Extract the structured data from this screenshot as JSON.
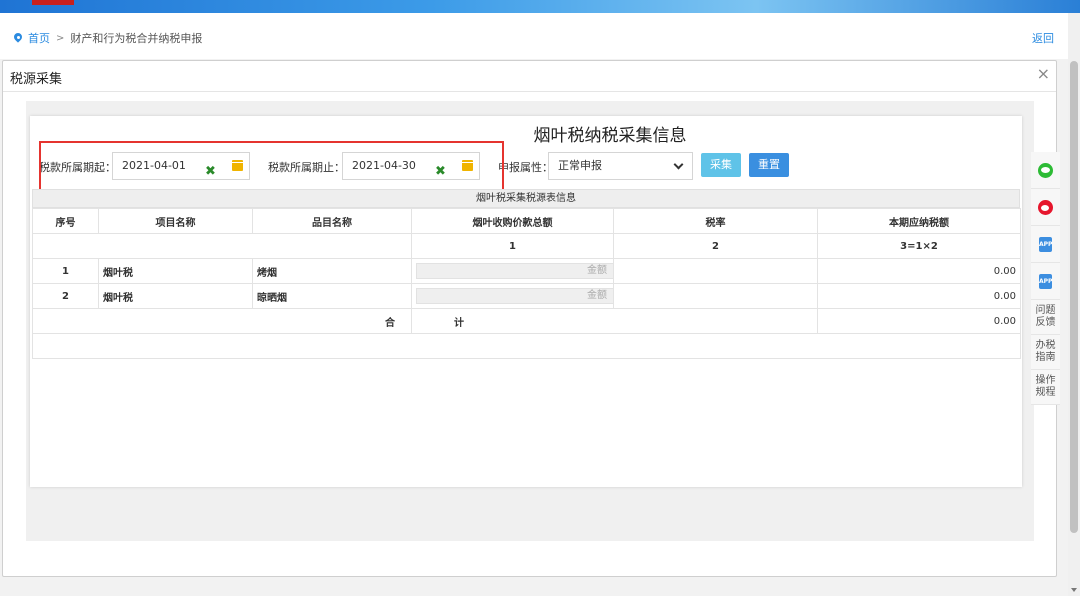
{
  "breadcrumb": {
    "home": "首页",
    "separator": ">",
    "current": "财产和行为税合并纳税申报",
    "back": "返回"
  },
  "modal": {
    "title": "税源采集",
    "close": "×"
  },
  "form": {
    "title": "烟叶税纳税采集信息",
    "period_start_label": "税款所属期起：",
    "period_start_value": "2021-04-01",
    "period_end_label": "税款所属期止：",
    "period_end_value": "2021-04-30",
    "report_type_label": "申报属性：",
    "report_type_value": "正常申报",
    "collect_button": "采集",
    "reset_button": "重置",
    "clear_symbol": "✖"
  },
  "table": {
    "caption": "烟叶税采集税源表信息",
    "headers": [
      "序号",
      "项目名称",
      "品目名称",
      "烟叶收购价款总额",
      "税率",
      "本期应纳税额"
    ],
    "formula_row": [
      "1",
      "2",
      "3=1×2"
    ],
    "rows": [
      {
        "index": "1",
        "item": "烟叶税",
        "category": "烤烟",
        "amount_placeholder": "金额",
        "rate": "",
        "tax": "0.00"
      },
      {
        "index": "2",
        "item": "烟叶税",
        "category": "晾晒烟",
        "amount_placeholder": "金额",
        "rate": "",
        "tax": "0.00"
      }
    ],
    "total_label_1": "合",
    "total_label_2": "计",
    "total_value": "0.00"
  },
  "side_toolbar": {
    "app_label": "APP",
    "feedback": "问题反馈",
    "guide": "办税指南",
    "procedure": "操作规程"
  },
  "colors": {
    "accent": "#2b8be0",
    "highlight": "#e5342f",
    "collect_button": "#5fc3e8",
    "reset_button": "#3a8fe0"
  }
}
